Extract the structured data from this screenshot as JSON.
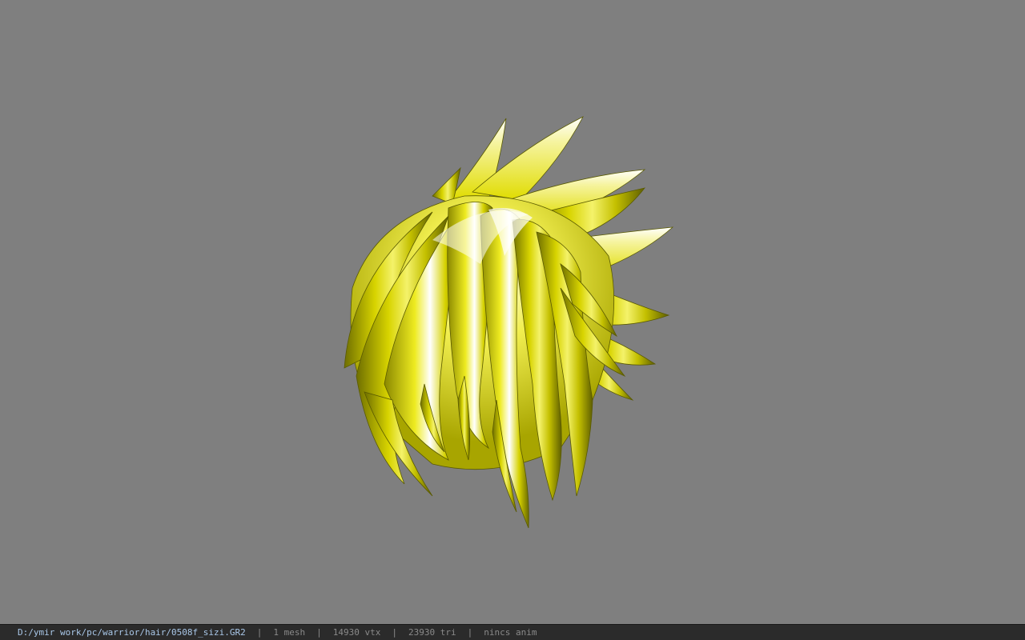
{
  "viewer": {
    "background_color": "#7f7f7f",
    "model_name": "hair mesh",
    "hair_base_color": "#c8c400",
    "hair_highlight_color": "#ffffff",
    "hair_shadow_color": "#7a7a00"
  },
  "statusbar": {
    "file_path": "D:/ymir work/pc/warrior/hair/0508f_sizi.GR2",
    "mesh_count": "1 mesh",
    "vertex_count": "14930 vtx",
    "triangle_count": "23930 tri",
    "anim_status": "nincs anim",
    "separator": "|"
  }
}
